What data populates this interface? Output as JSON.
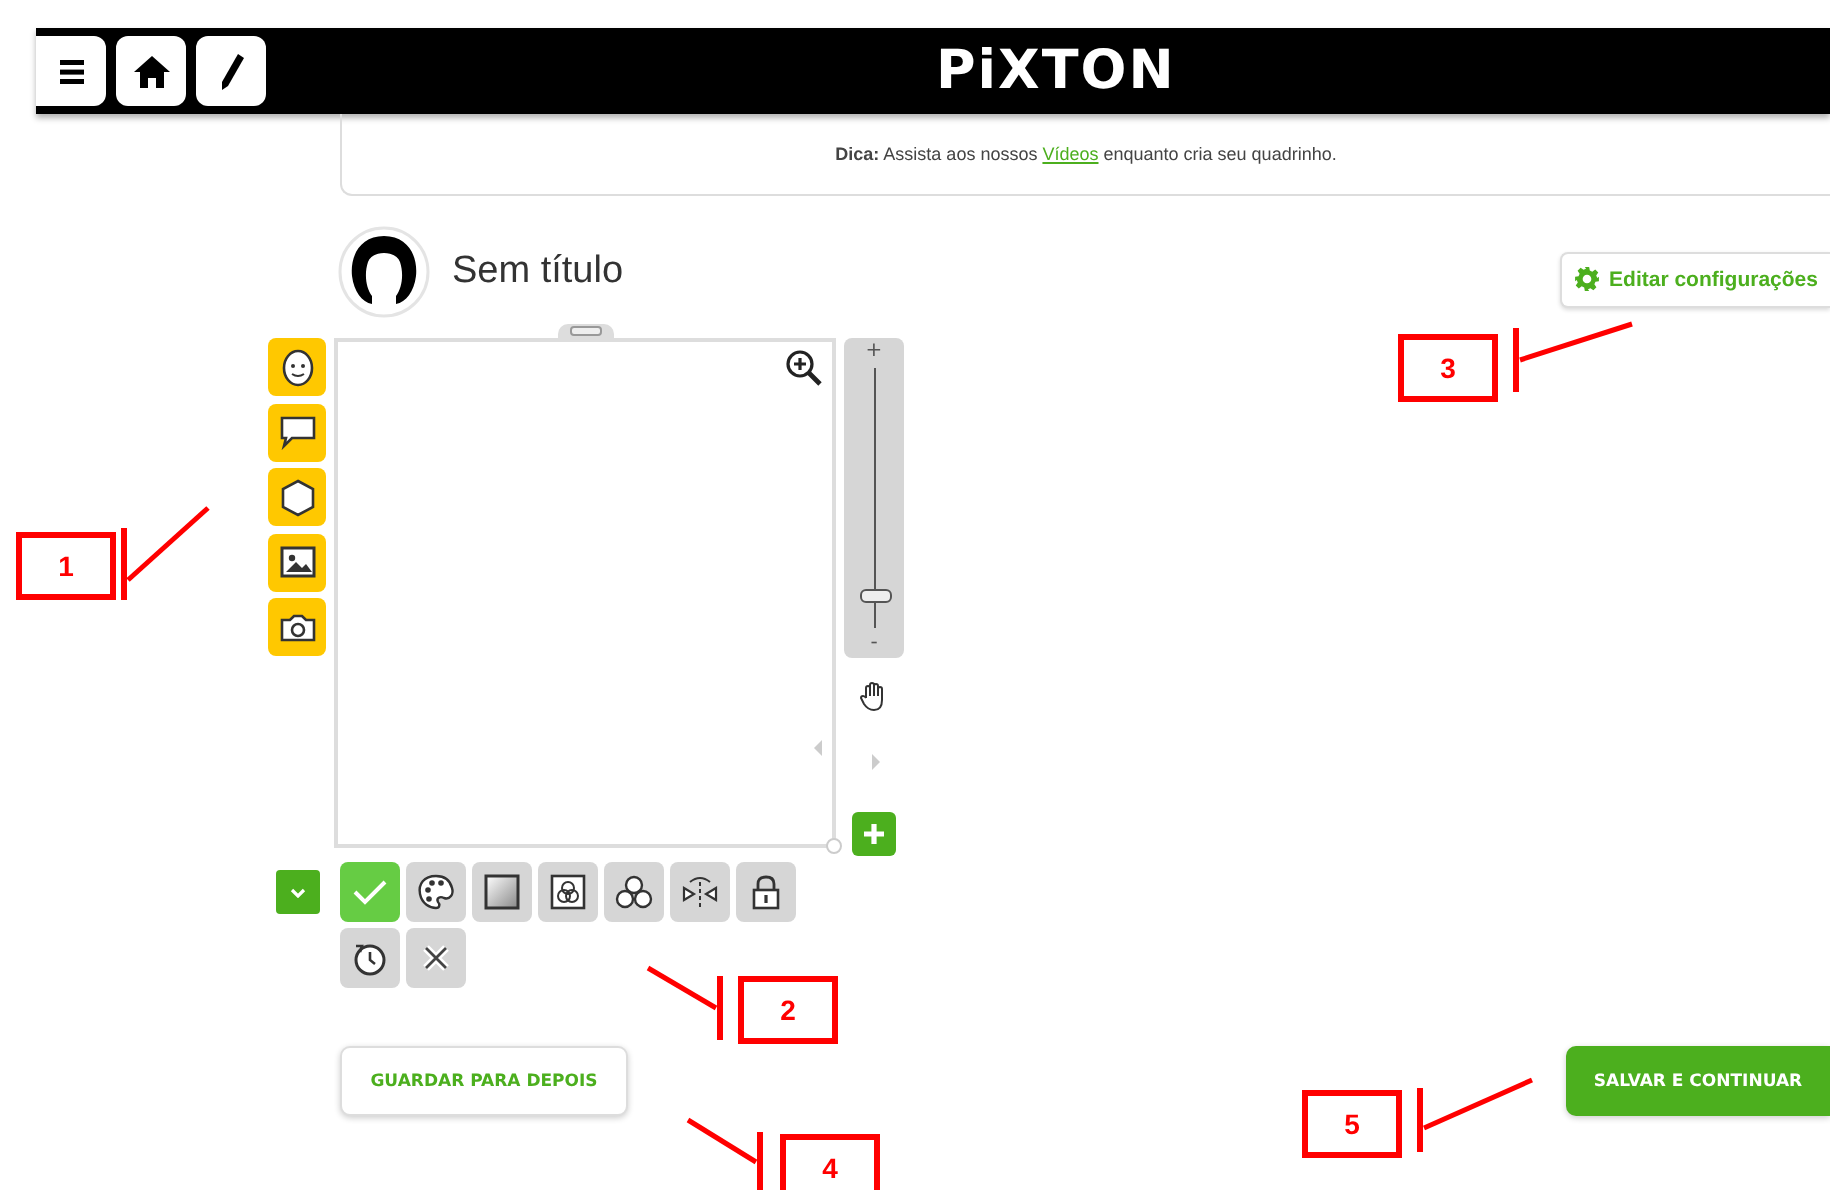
{
  "header": {
    "logo": "PiXTON"
  },
  "tip": {
    "before": "**Dica:** Assista aos nossos ",
    "link": "Vídeos",
    "after": " enquanto cria seu quadrinho."
  },
  "comic": {
    "title": "Sem título"
  },
  "settings_button": {
    "label": "Editar configurações"
  },
  "zoom_slider": {
    "plus": "+",
    "minus": "-",
    "level": 0.12
  },
  "footer_buttons": [
    {
      "label": "GUARDAR PARA DEPOIS",
      "kind": "secondary"
    },
    {
      "label": "SALVAR E CONTINUAR",
      "kind": "primary"
    }
  ],
  "callouts": [
    {
      "label": "1"
    },
    {
      "label": "2"
    },
    {
      "label": "3"
    },
    {
      "label": "4"
    },
    {
      "label": "5"
    }
  ]
}
